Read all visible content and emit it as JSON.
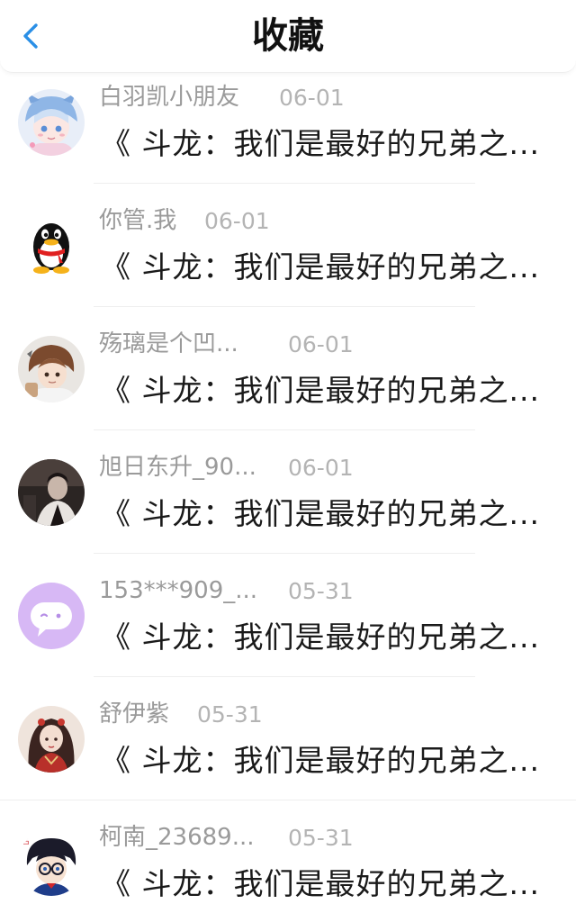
{
  "header": {
    "title": "收藏",
    "back_icon": "chevron-left-icon",
    "accent_color": "#2a8fe6"
  },
  "items": [
    {
      "name": "白羽凯小朋友",
      "date": "06-01",
      "content": "《 斗龙：我们是最好的兄弟之...",
      "avatar": "anime-girl-avatar"
    },
    {
      "name": "你管.我",
      "date": "06-01",
      "content": "《 斗龙：我们是最好的兄弟之...",
      "avatar": "qq-penguin-avatar"
    },
    {
      "name": "殇璃是个凹...",
      "date": "06-01",
      "content": "《 斗龙：我们是最好的兄弟之...",
      "avatar": "anime-boy-avatar"
    },
    {
      "name": "旭日东升_90...",
      "date": "06-01",
      "content": "《 斗龙：我们是最好的兄弟之...",
      "avatar": "dark-photo-avatar"
    },
    {
      "name": "153***909_...",
      "date": "05-31",
      "content": "《 斗龙：我们是最好的兄弟之...",
      "avatar": "purple-chat-avatar"
    },
    {
      "name": "舒伊紫",
      "date": "05-31",
      "content": "《 斗龙：我们是最好的兄弟之...",
      "avatar": "costume-girl-avatar"
    },
    {
      "name": "柯南_23689...",
      "date": "05-31",
      "content": "《 斗龙：我们是最好的兄弟之...",
      "avatar": "detective-avatar"
    }
  ]
}
